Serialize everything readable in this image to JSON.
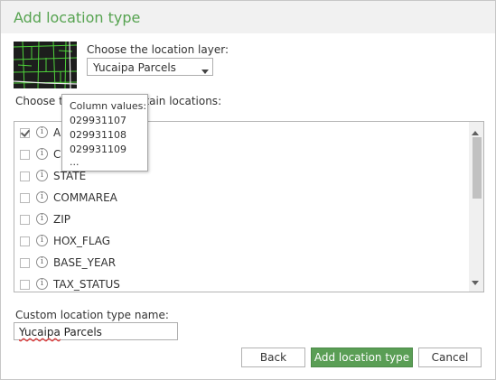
{
  "dialog": {
    "title": "Add location type",
    "layer_label": "Choose the location layer:",
    "layer_selected": "Yucaipa Parcels",
    "fields_label_start": "Choose th",
    "fields_label_end": "ontain locations:",
    "fields": [
      {
        "name": "AP",
        "checked": true
      },
      {
        "name": "CI",
        "checked": false
      },
      {
        "name": "STATE",
        "checked": false
      },
      {
        "name": "COMMAREA",
        "checked": false
      },
      {
        "name": "ZIP",
        "checked": false
      },
      {
        "name": "HOX_FLAG",
        "checked": false
      },
      {
        "name": "BASE_YEAR",
        "checked": false
      },
      {
        "name": "TAX_STATUS",
        "checked": false
      }
    ],
    "tooltip": {
      "header": "Column values:",
      "values": [
        "029931107",
        "029931108",
        "029931109",
        "..."
      ]
    },
    "name_label": "Custom location type name:",
    "name_value_word1": "Yucaipa",
    "name_value_word2": " Parcels",
    "buttons": {
      "back": "Back",
      "add": "Add location type",
      "cancel": "Cancel"
    },
    "colors": {
      "title": "#56a350",
      "primary_button": "#5a9e55"
    }
  }
}
